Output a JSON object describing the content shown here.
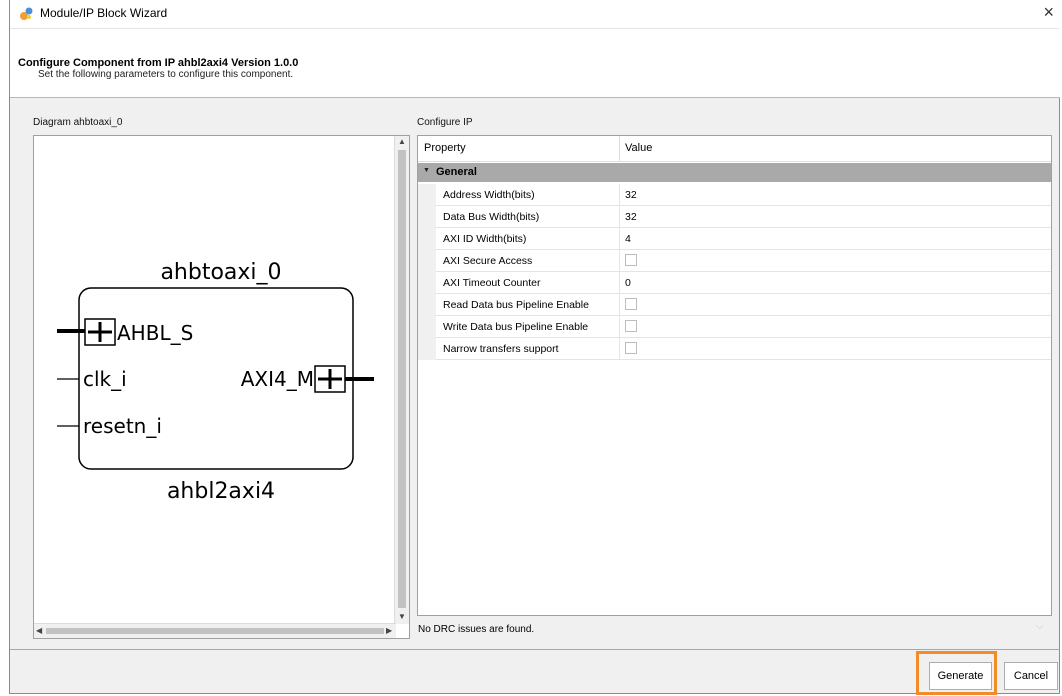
{
  "window": {
    "title": "Module/IP Block Wizard",
    "close_glyph": "×"
  },
  "header": {
    "title": "Configure Component from IP ahbl2axi4 Version 1.0.0",
    "subtitle": "Set the following parameters to configure this component."
  },
  "diagram": {
    "label": "Diagram ahbtoaxi_0",
    "instance_name": "ahbtoaxi_0",
    "module_name": "ahbl2axi4",
    "ports_left": [
      "AHBL_S",
      "clk_i",
      "resetn_i"
    ],
    "ports_right": [
      "AXI4_M"
    ]
  },
  "configure": {
    "label": "Configure IP",
    "col_property": "Property",
    "col_value": "Value",
    "group": "General",
    "rows": [
      {
        "name": "Address Width(bits)",
        "value": "32"
      },
      {
        "name": "Data Bus Width(bits)",
        "value": "32"
      },
      {
        "name": "AXI ID Width(bits)",
        "value": "4"
      },
      {
        "name": "AXI Secure Access",
        "checked": false
      },
      {
        "name": "AXI Timeout Counter",
        "value": "0"
      },
      {
        "name": "Read Data bus Pipeline Enable",
        "checked": false
      },
      {
        "name": "Write Data bus Pipeline Enable",
        "checked": false
      },
      {
        "name": "Narrow transfers support",
        "checked": false
      }
    ]
  },
  "status": {
    "drc": "No DRC issues are found."
  },
  "buttons": {
    "generate": "Generate",
    "cancel": "Cancel"
  },
  "colors": {
    "highlight": "#f28c28",
    "group_row": "#a9a9a9"
  },
  "icons": [
    "wizard-app-icon",
    "close-icon",
    "plus-icon",
    "expand-triangle-icon"
  ]
}
